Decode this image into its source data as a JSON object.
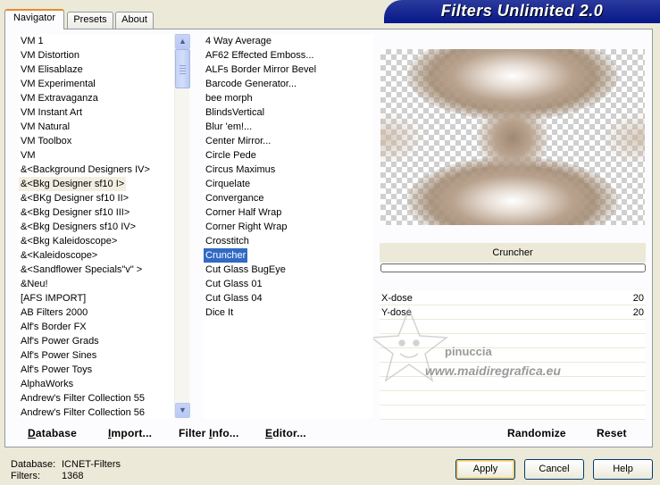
{
  "tabs": [
    {
      "label": "Navigator",
      "active": true
    },
    {
      "label": "Presets",
      "active": false
    },
    {
      "label": "About",
      "active": false
    }
  ],
  "banner": {
    "title": "Filters Unlimited 2.0"
  },
  "categories": {
    "items": [
      "VM 1",
      "VM Distortion",
      "VM Elisablaze",
      "VM Experimental",
      "VM Extravaganza",
      "VM Instant Art",
      "VM Natural",
      "VM Toolbox",
      "VM",
      "&<Background Designers IV>",
      "&<Bkg Designer sf10 I>",
      "&<BKg Designer sf10 II>",
      "&<Bkg Designer sf10 III>",
      "&<Bkg Designers sf10 IV>",
      "&<Bkg Kaleidoscope>",
      "&<Kaleidoscope>",
      "&<Sandflower Specials\"v\" >",
      "&Neu!",
      "[AFS IMPORT]",
      "AB Filters 2000",
      "Alf's Border FX",
      "Alf's Power Grads",
      "Alf's Power Sines",
      "Alf's Power Toys",
      "AlphaWorks",
      "Andrew's Filter Collection 55",
      "Andrew's Filter Collection 56"
    ],
    "selected_index": 10
  },
  "filters": {
    "items": [
      "4 Way Average",
      "AF62 Effected Emboss...",
      "ALFs Border Mirror Bevel",
      "Barcode Generator...",
      "bee morph",
      "BlindsVertical",
      "Blur 'em!...",
      "Center Mirror...",
      "Circle Pede",
      "Circus Maximus",
      "Cirquelate",
      "Convergance",
      "Corner Half Wrap",
      "Corner Right Wrap",
      "Crosstitch",
      "Cruncher",
      "Cut Glass  BugEye",
      "Cut Glass 01",
      "Cut Glass 04",
      "Dice It"
    ],
    "selected_index": 15
  },
  "preview": {
    "filter_name": "Cruncher",
    "progress": 0
  },
  "parameters": [
    {
      "label": "X-dose",
      "value": "20"
    },
    {
      "label": "Y-dose",
      "value": "20"
    }
  ],
  "toolbar": {
    "database": {
      "underlined": "D",
      "rest": "atabase"
    },
    "import": {
      "pre": "",
      "underlined": "I",
      "rest": "mport..."
    },
    "filter_info": {
      "pre": "Filter ",
      "underlined": "I",
      "rest": "nfo..."
    },
    "editor": {
      "pre": "",
      "underlined": "E",
      "rest": "ditor..."
    },
    "randomize": "Randomize",
    "reset": "Reset"
  },
  "status": {
    "database_label": "Database:",
    "database_value": "ICNET-Filters",
    "filters_label": "Filters:",
    "filters_value": "1368"
  },
  "buttons": {
    "apply": "Apply",
    "cancel": "Cancel",
    "help": "Help"
  },
  "watermark": {
    "line1": "pinuccia",
    "line2": "www.maidiregrafica.eu"
  },
  "colors": {
    "selection_blue": "#316ac5",
    "banner_blue": "#0a1a8a",
    "tab_accent": "#e68b2c"
  }
}
